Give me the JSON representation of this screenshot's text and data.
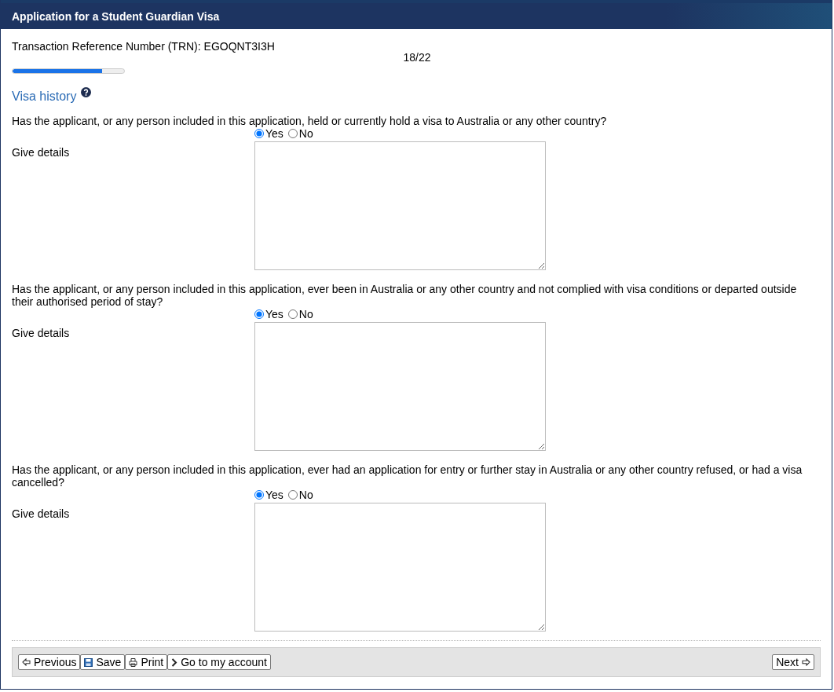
{
  "window": {
    "title": "Application for a Student Guardian Visa"
  },
  "trn": "Transaction Reference Number (TRN): EGOQNT3I3H",
  "progress": {
    "reading": "18/22",
    "level": 0.8
  },
  "section": {
    "title": "Visa history"
  },
  "questions": [
    {
      "text": "Has the applicant, or any person included in this application, held or currently hold a visa to Australia or any other country?",
      "options": [
        {
          "label": "Yes",
          "selected": true
        },
        {
          "label": "No",
          "selected": false
        }
      ],
      "details_label": "Give details"
    },
    {
      "text": "Has the applicant, or any person included in this application, ever been in Australia or any other country and not complied with visa conditions or departed outside their authorised period of stay?",
      "options": [
        {
          "label": "Yes",
          "selected": true
        },
        {
          "label": "No",
          "selected": false
        }
      ],
      "details_label": "Give details"
    },
    {
      "text": "Has the applicant, or any person included in this application, ever had an application for entry or further stay in Australia or any other country refused, or had a visa cancelled?",
      "options": [
        {
          "label": "Yes",
          "selected": true
        },
        {
          "label": "No",
          "selected": false
        }
      ],
      "details_label": "Give details"
    }
  ],
  "buttons": [
    {
      "kind": "previous",
      "label": "Previous"
    },
    {
      "kind": "save",
      "label": "Save"
    },
    {
      "kind": "print",
      "label": "Print"
    },
    {
      "kind": "account",
      "label": "Go to my account"
    },
    {
      "kind": "next",
      "label": "Next"
    }
  ]
}
